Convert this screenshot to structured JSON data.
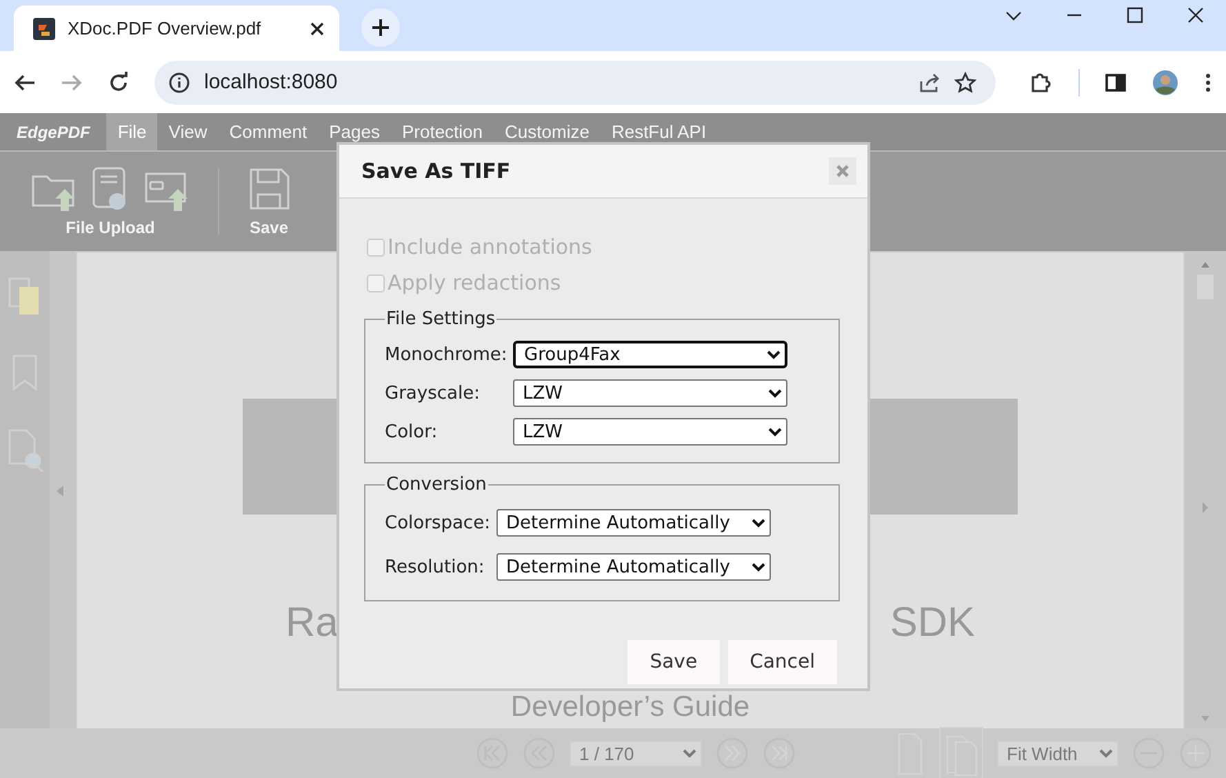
{
  "browser": {
    "tab_title": "XDoc.PDF Overview.pdf",
    "address": "localhost:8080"
  },
  "app": {
    "brand": "EdgePDF",
    "menu": [
      {
        "label": "File",
        "selected": true
      },
      {
        "label": "View",
        "selected": false
      },
      {
        "label": "Comment",
        "selected": false
      },
      {
        "label": "Pages",
        "selected": false
      },
      {
        "label": "Protection",
        "selected": false
      },
      {
        "label": "Customize",
        "selected": false
      },
      {
        "label": "RestFul API",
        "selected": false
      }
    ],
    "toolbar_groups": [
      {
        "label": "File Upload",
        "kind": "upload"
      },
      {
        "label": "Save",
        "kind": "save"
      }
    ]
  },
  "document": {
    "title_left": "Ra",
    "title_right": "SDK",
    "subtitle": "Developer’s Guide"
  },
  "dialog": {
    "title": "Save As TIFF",
    "options": [
      {
        "label": "Include annotations",
        "checked": false,
        "disabled": true
      },
      {
        "label": "Apply redactions",
        "checked": false,
        "disabled": true
      }
    ],
    "fieldsets": [
      {
        "legend": "File Settings",
        "fields": [
          {
            "label": "Monochrome:",
            "value": "Group4Fax",
            "focused": true
          },
          {
            "label": "Grayscale:",
            "value": "LZW",
            "focused": false
          },
          {
            "label": "Color:",
            "value": "LZW",
            "focused": false
          }
        ]
      },
      {
        "legend": "Conversion",
        "fields": [
          {
            "label": "Colorspace:",
            "value": "Determine Automatically",
            "focused": false
          },
          {
            "label": "Resolution:",
            "value": "Determine Automatically",
            "focused": false
          }
        ]
      }
    ],
    "buttons": [
      "Save",
      "Cancel"
    ]
  },
  "bottom_bar": {
    "page": "1 / 170",
    "zoom": "Fit Width"
  }
}
